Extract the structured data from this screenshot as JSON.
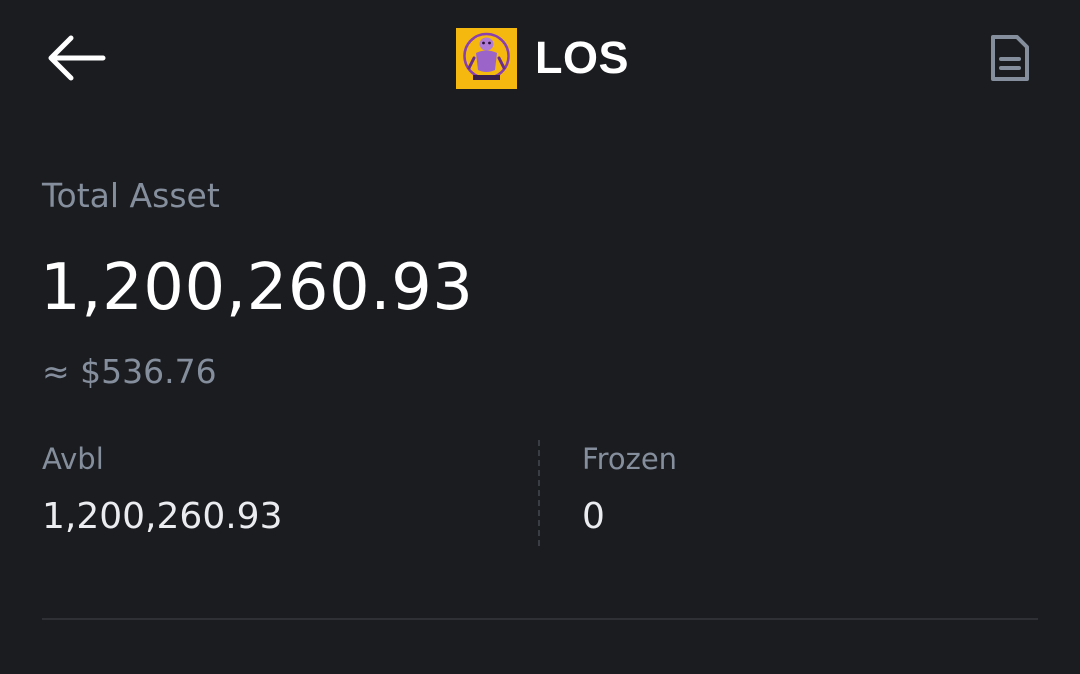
{
  "header": {
    "token_symbol": "LOS",
    "back_icon": "arrow-left-icon",
    "history_icon": "document-icon",
    "logo_colors": {
      "background": "#f5b80f",
      "figure": "#b07bd6"
    }
  },
  "balance": {
    "total_label": "Total Asset",
    "total_value": "1,200,260.93",
    "total_usd": "≈ $536.76"
  },
  "breakdown": {
    "avbl_label": "Avbl",
    "avbl_value": "1,200,260.93",
    "frozen_label": "Frozen",
    "frozen_value": "0"
  },
  "colors": {
    "background": "#1b1c20",
    "primary_text": "#ffffff",
    "secondary_text": "#848e9c",
    "divider": "#2e3036"
  }
}
